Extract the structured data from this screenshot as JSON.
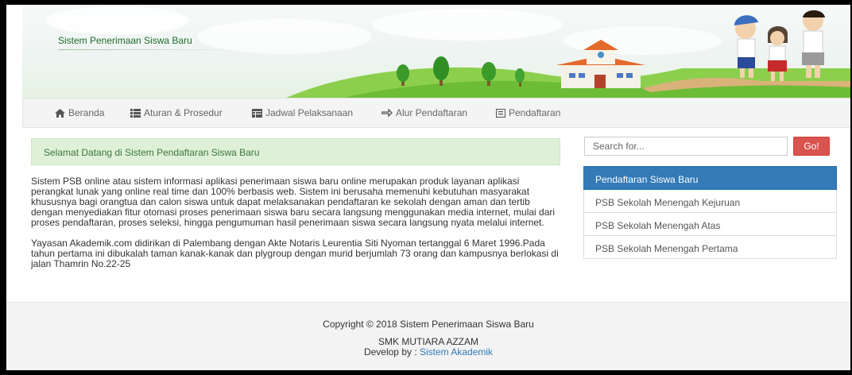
{
  "header": {
    "title": "Sistem Penerimaan Siswa Baru"
  },
  "nav": {
    "items": [
      {
        "label": "Beranda",
        "icon": "home-icon"
      },
      {
        "label": "Aturan & Prosedur",
        "icon": "list-icon"
      },
      {
        "label": "Jadwal Pelaksanaan",
        "icon": "table-icon"
      },
      {
        "label": "Alur Pendaftaran",
        "icon": "transfer-icon"
      },
      {
        "label": "Pendaftaran",
        "icon": "form-icon"
      }
    ]
  },
  "alert": {
    "text": "Selamat Datang di Sistem Pendaftaran Siswa Baru"
  },
  "content": {
    "paragraphs": [
      "Sistem PSB online atau sistem informasi aplikasi penerimaan siswa baru online merupakan produk layanan aplikasi perangkat lunak yang online real time dan 100% berbasis web. Sistem ini berusaha memenuhi kebutuhan masyarakat khususnya bagi orangtua dan calon siswa untuk dapat melaksanakan pendaftaran ke sekolah dengan aman dan tertib dengan menyediakan fitur otomasi proses penerimaan siswa baru secara langsung menggunakan media internet, mulai dari proses pendaftaran, proses seleksi, hingga pengumuman hasil penerimaan siswa secara langsung nyata melalui internet.",
      "Yayasan Akademik.com didirikan di Palembang dengan Akte Notaris Leurentia Siti Nyoman tertanggal 6 Maret 1996.Pada tahun pertama ini dibukalah taman kanak-kanak dan plygroup dengan murid berjumlah 73 orang dan kampusnya berlokasi di jalan Thamrin No.22-25"
    ]
  },
  "search": {
    "placeholder": "Search for...",
    "button_label": "Go!"
  },
  "sidebar": {
    "heading": "Pendaftaran Siswa Baru",
    "items": [
      "PSB Sekolah Menengah Kejuruan",
      "PSB Sekolah Menengah Atas",
      "PSB Sekolah Menengah Pertama"
    ]
  },
  "footer": {
    "copyright": "Copyright © 2018 Sistem Penerimaan Siswa Baru",
    "school": "SMK MUTIARA AZZAM",
    "develop_prefix": "Develop by : ",
    "develop_link": "Sistem Akademik"
  },
  "colors": {
    "alert_bg": "#dff0d8",
    "alert_text": "#3c763d",
    "primary": "#337ab7",
    "danger": "#d9534f",
    "header_title": "#1e6b2a"
  }
}
